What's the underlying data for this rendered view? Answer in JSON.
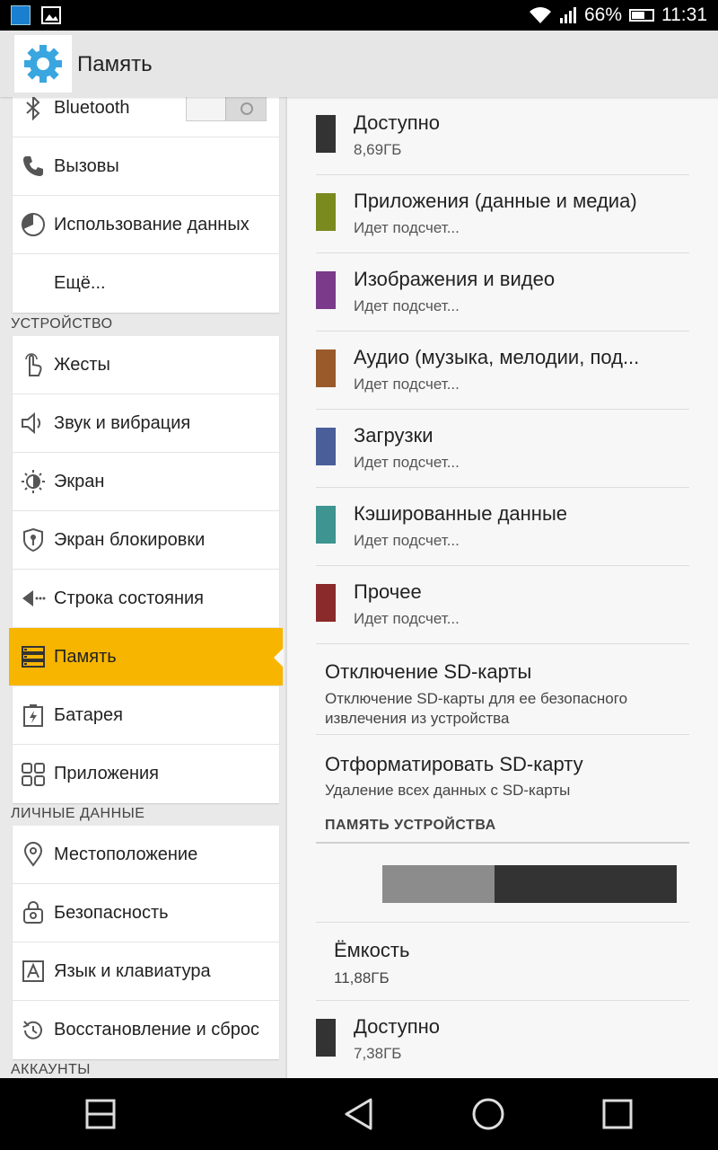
{
  "status_bar": {
    "battery": "66%",
    "battery_level": 0.66,
    "time": "11:31"
  },
  "action_bar": {
    "title": "Память",
    "icon": "gear-icon"
  },
  "sidebar": {
    "group1": [
      {
        "label": "Bluetooth",
        "icon": "bluetooth-icon",
        "toggle": "off"
      },
      {
        "label": "Вызовы",
        "icon": "phone-icon"
      },
      {
        "label": "Использование данных",
        "icon": "data-usage-icon"
      },
      {
        "label": "Ещё..."
      }
    ],
    "section_device": "УСТРОЙСТВО",
    "group2": [
      {
        "label": "Жесты",
        "icon": "gesture-icon"
      },
      {
        "label": "Звук и вибрация",
        "icon": "speaker-icon"
      },
      {
        "label": "Экран",
        "icon": "brightness-icon"
      },
      {
        "label": "Экран блокировки",
        "icon": "lock-screen-icon"
      },
      {
        "label": "Строка состояния",
        "icon": "status-bar-icon"
      },
      {
        "label": "Память",
        "icon": "storage-icon",
        "active": true
      },
      {
        "label": "Батарея",
        "icon": "battery-icon"
      },
      {
        "label": "Приложения",
        "icon": "apps-icon"
      }
    ],
    "section_personal": "ЛИЧНЫЕ ДАННЫЕ",
    "group3": [
      {
        "label": "Местоположение",
        "icon": "location-icon"
      },
      {
        "label": "Безопасность",
        "icon": "security-icon"
      },
      {
        "label": "Язык и клавиатура",
        "icon": "language-icon"
      },
      {
        "label": "Восстановление и сброс",
        "icon": "restore-icon"
      }
    ],
    "section_accounts": "АККАУНТЫ"
  },
  "storage": {
    "items": [
      {
        "title": "Доступно",
        "sub": "8,69ГБ",
        "color": "#333333"
      },
      {
        "title": "Приложения (данные и медиа)",
        "sub": "Идет подсчет...",
        "color": "#7b8a1e"
      },
      {
        "title": "Изображения и видео",
        "sub": "Идет подсчет...",
        "color": "#7c3a8a"
      },
      {
        "title": "Аудио (музыка, мелодии, под...",
        "sub": "Идет подсчет...",
        "color": "#9a5a2a"
      },
      {
        "title": "Загрузки",
        "sub": "Идет подсчет...",
        "color": "#4a5e99"
      },
      {
        "title": "Кэшированные данные",
        "sub": "Идет подсчет...",
        "color": "#3d9490"
      },
      {
        "title": "Прочее",
        "sub": "Идет подсчет...",
        "color": "#8a2a2a"
      }
    ],
    "unmount": {
      "title": "Отключение SD-карты",
      "sub": "Отключение SD-карты для ее безопасного извлечения из устройства"
    },
    "format": {
      "title": "Отформатировать SD-карту",
      "sub": "Удаление всех данных с SD-карты"
    },
    "device_section": "ПАМЯТЬ УСТРОЙСТВА",
    "usage_bar": {
      "used_fraction": 0.38
    },
    "capacity": {
      "title": "Ёмкость",
      "sub": "11,88ГБ"
    },
    "device_available": {
      "title": "Доступно",
      "sub": "7,38ГБ",
      "color": "#333333"
    }
  }
}
